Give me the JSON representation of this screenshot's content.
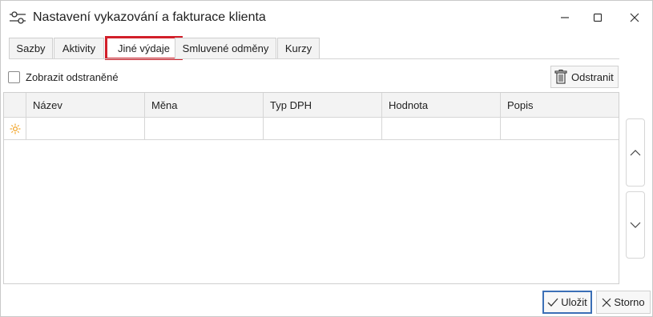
{
  "window": {
    "title": "Nastavení vykazování a fakturace klienta",
    "icon": "sliders-icon"
  },
  "tabs": [
    {
      "label": "Sazby",
      "active": false
    },
    {
      "label": "Aktivity",
      "active": false
    },
    {
      "label": "Jiné výdaje",
      "active": true,
      "highlighted": true
    },
    {
      "label": "Smluvené odměny",
      "active": false
    },
    {
      "label": "Kurzy",
      "active": false
    }
  ],
  "toolbar": {
    "show_deleted_label": "Zobrazit odstraněné",
    "show_deleted_checked": false,
    "remove_label": "Odstranit"
  },
  "grid": {
    "columns": [
      "Název",
      "Měna",
      "Typ DPH",
      "Hodnota",
      "Popis"
    ],
    "new_row_icon": "new-row-sun-icon",
    "rows": []
  },
  "footer": {
    "save_label": "Uložit",
    "cancel_label": "Storno"
  },
  "colors": {
    "highlight": "#d21f2a",
    "save_border": "#3b6fb6",
    "new_row_icon": "#f0a020"
  }
}
